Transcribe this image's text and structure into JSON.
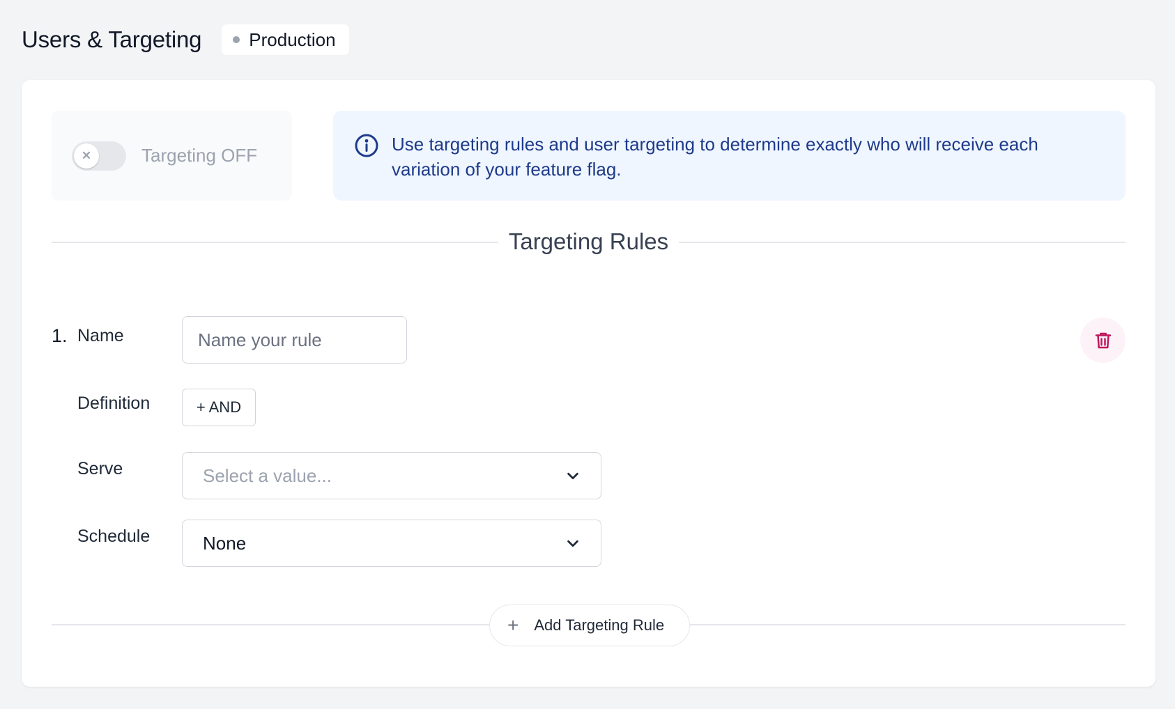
{
  "header": {
    "title": "Users & Targeting",
    "environment": "Production"
  },
  "targeting": {
    "toggle_label": "Targeting OFF",
    "enabled": false
  },
  "info": {
    "message": "Use targeting rules and user targeting to determine exactly who will receive each variation of your feature flag."
  },
  "rules_section": {
    "title": "Targeting Rules",
    "rules": [
      {
        "number": "1.",
        "name_label": "Name",
        "name_value": "",
        "name_placeholder": "Name your rule",
        "definition_label": "Definition",
        "and_button_label": "+ AND",
        "serve_label": "Serve",
        "serve_placeholder": "Select a value...",
        "schedule_label": "Schedule",
        "schedule_value": "None"
      }
    ],
    "add_rule_label": "Add Targeting Rule"
  },
  "colors": {
    "info_text": "#1e3a8a",
    "info_bg": "#eff6ff",
    "delete_icon": "#be185d",
    "delete_bg": "#fdf2f8"
  },
  "icons": {
    "info": "info-circle-icon",
    "toggle_off": "x-icon",
    "delete": "trash-icon",
    "chevron": "chevron-down-icon",
    "add": "plus-icon"
  }
}
